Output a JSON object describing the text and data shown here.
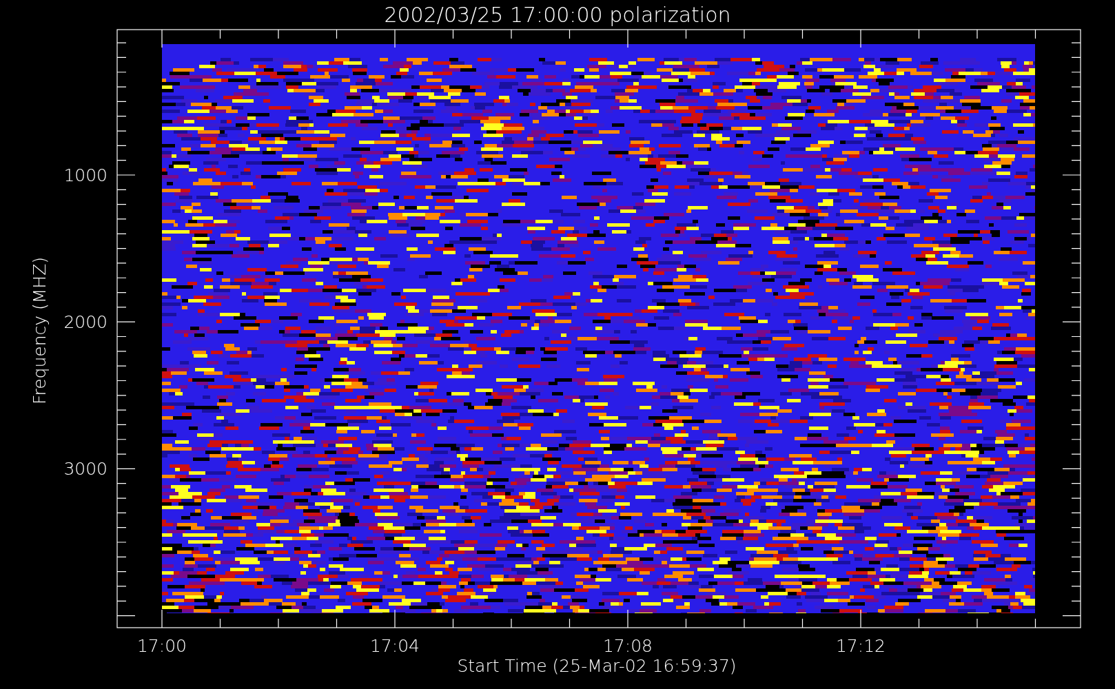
{
  "title": "2002/03/25 17:00:00 polarization",
  "y_axis": {
    "label": "Frequency (MHZ)",
    "ticks": [
      "1000",
      "2000",
      "3000"
    ]
  },
  "x_axis": {
    "label": "Start Time (25-Mar-02 16:59:37)",
    "ticks": [
      "17:00",
      "17:04",
      "17:08",
      "17:12"
    ]
  }
}
